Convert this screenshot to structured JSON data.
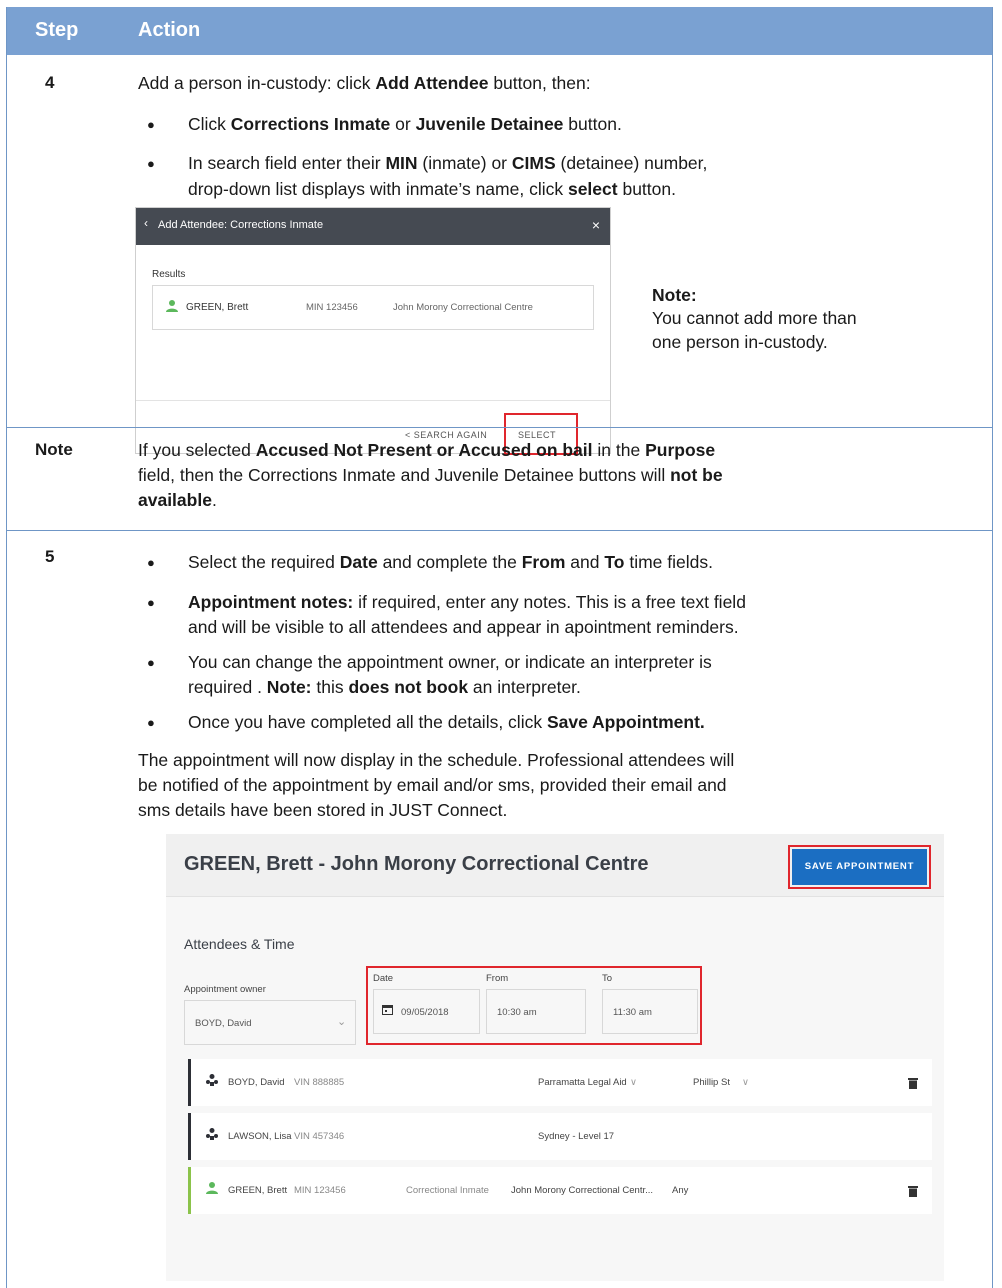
{
  "header": {
    "step": "Step",
    "action": "Action"
  },
  "row4": {
    "step": "4",
    "intro": [
      "Add a person in-custody: click ",
      "Add Attendee",
      " button, then:"
    ],
    "bullet1": [
      "Click ",
      "Corrections Inmate",
      " or ",
      "Juvenile Detainee",
      " button."
    ],
    "bullet2_line1": [
      "In search field enter their ",
      "MIN",
      " (inmate) or ",
      "CIMS",
      " (detainee) number,"
    ],
    "bullet2_line2": [
      "drop-down list displays with inmate’s name, click ",
      "select",
      " button."
    ],
    "note_title": "Note:",
    "note_line1": "You cannot add more than",
    "note_line2": "one person in-custody."
  },
  "shot1": {
    "title": "Add Attendee: Corrections Inmate",
    "results_label": "Results",
    "result_name": "GREEN, Brett",
    "result_min": "MIN 123456",
    "result_centre": "John Morony Correctional Centre",
    "search_again": "< SEARCH AGAIN",
    "select": "SELECT"
  },
  "note_row": {
    "label": "Note",
    "line1": [
      "If you selected ",
      "Accused Not Present or Accused on bail",
      " in the ",
      "Purpose"
    ],
    "line2": [
      "field, then the Corrections Inmate and Juvenile Detainee buttons will ",
      "not be"
    ],
    "line3": [
      "available",
      "."
    ]
  },
  "row5": {
    "step": "5",
    "b1": [
      "Select the required ",
      "Date",
      " and complete the ",
      "From",
      " and ",
      "To",
      " time fields."
    ],
    "b2_line1": [
      "Appointment notes:",
      " if required, enter any notes. This is a free text field"
    ],
    "b2_line2": "and  will be visible to all attendees and appear in apointment reminders.",
    "b3_line1": "You can change the appointment owner, or indicate an interpreter is",
    "b3_line2": [
      "required . ",
      "Note:",
      " this ",
      "does not book",
      " an interpreter."
    ],
    "b4": [
      "Once you have completed all the details, click ",
      "Save Appointment."
    ],
    "p_line1": "The appointment will now display in the schedule. Professional attendees will",
    "p_line2": "be notified of the appointment by email and/or sms, provided their email and",
    "p_line3": "sms details have been stored in JUST Connect."
  },
  "shot2": {
    "title": "GREEN, Brett - John Morony Correctional Centre",
    "save_button": "SAVE APPOINTMENT",
    "section": "Attendees & Time",
    "owner_label": "Appointment owner",
    "owner_value": "BOYD, David",
    "date_label": "Date",
    "date_value": "09/05/2018",
    "from_label": "From",
    "from_value": "10:30 am",
    "to_label": "To",
    "to_value": "11:30 am",
    "attendees": [
      {
        "name": "BOYD, David",
        "id": "VIN 888885",
        "type": "",
        "location": "Parramatta Legal Aid",
        "site": "Phillip St"
      },
      {
        "name": "LAWSON, Lisa",
        "id": "VIN 457346",
        "type": "",
        "location": "Sydney - Level 17",
        "site": ""
      },
      {
        "name": "GREEN, Brett",
        "id": "MIN 123456",
        "type": "Correctional Inmate",
        "location": "John Morony Correctional Centr...",
        "site": "Any"
      }
    ]
  }
}
